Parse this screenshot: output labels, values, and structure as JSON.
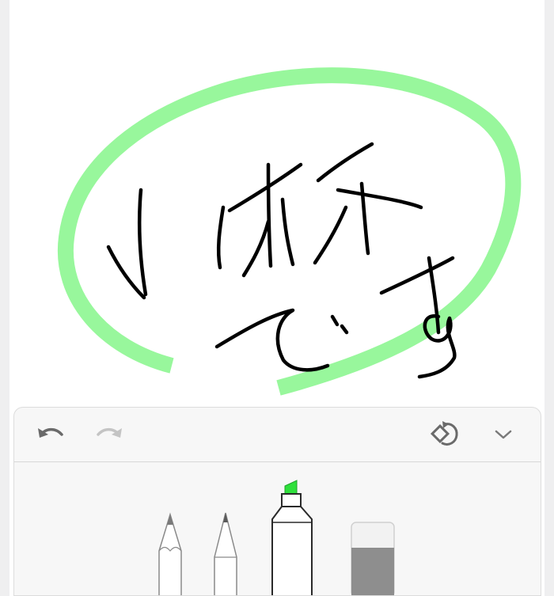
{
  "canvas": {
    "ink_color": "#000000",
    "highlighter_color": "#98f79c"
  },
  "toolbar": {
    "icons": {
      "undo": "undo-arrow-icon",
      "redo": "redo-arrow-icon",
      "lasso": "lasso-rotate-icon",
      "collapse": "chevron-down-icon"
    },
    "tools": [
      "pencil",
      "pen",
      "marker",
      "eraser"
    ],
    "selected_tool": "marker",
    "marker_color": "#2ee03b",
    "eraser_color": "#8e8e8e",
    "redo_enabled": false
  }
}
